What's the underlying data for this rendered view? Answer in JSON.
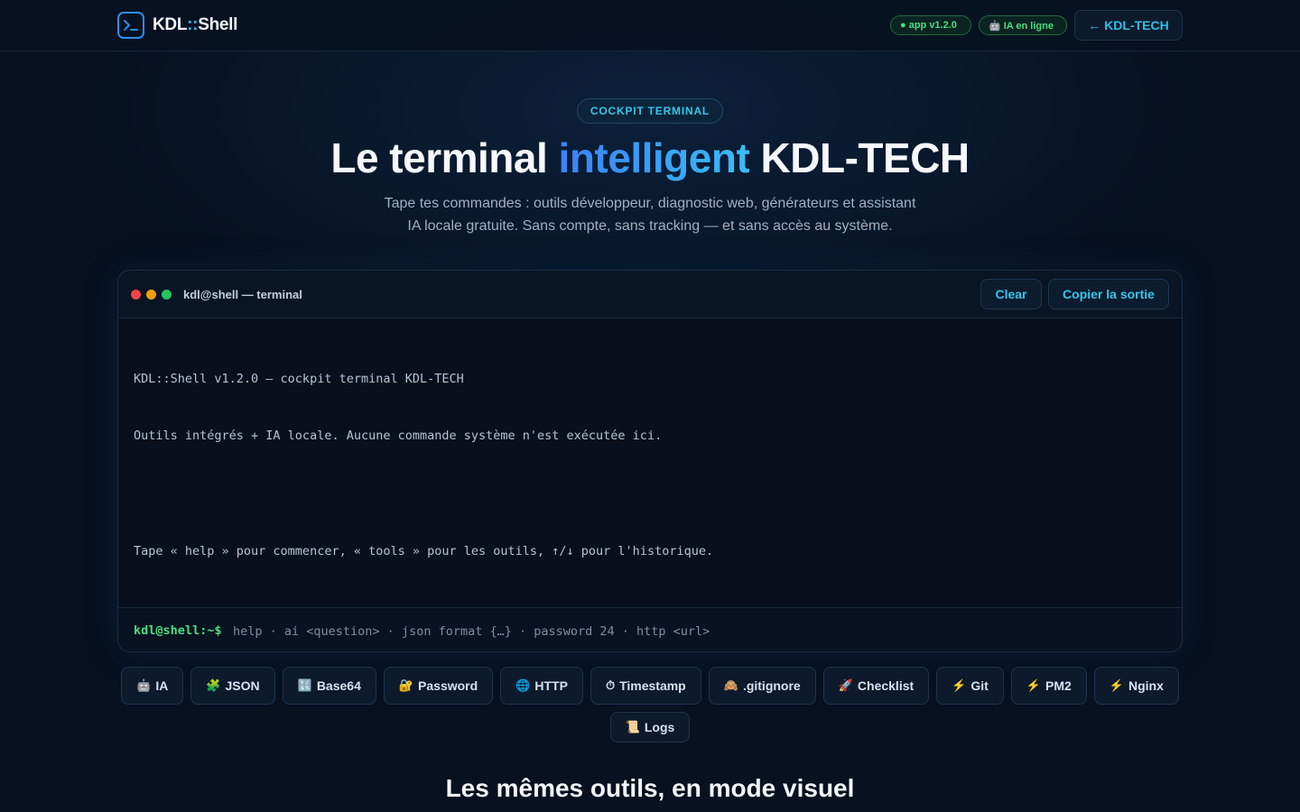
{
  "header": {
    "brand_prefix": "KDL",
    "brand_sep": "::",
    "brand_suffix": "Shell",
    "app_version": "● app v1.2.0",
    "ia_status": "🤖 IA en ligne",
    "back_link": "← KDL-TECH",
    "status_color": "#4ade80",
    "accent_color": "#2fc0e8"
  },
  "hero": {
    "badge": "COCKPIT TERMINAL",
    "title_start": "Le terminal ",
    "title_accent": "intelligent",
    "title_end": " KDL-TECH",
    "subtitle_line1": "Tape tes commandes : outils développeur, diagnostic web, générateurs et assistant",
    "subtitle_line2": "IA locale gratuite. Sans compte, sans tracking — et sans accès au système."
  },
  "terminal": {
    "title": "kdl@shell — terminal",
    "clear_label": "Clear",
    "copy_label": "Copier la sortie",
    "output": [
      "KDL::Shell v1.2.0 — cockpit terminal KDL-TECH",
      "Outils intégrés + IA locale. Aucune commande système n'est exécutée ici.",
      "Tape « help » pour commencer, « tools » pour les outils, ↑/↓ pour l'historique."
    ],
    "prompt": "kdl@shell:~$",
    "input_placeholder": "help · ai <question> · json format {…} · password 24 · http <url>"
  },
  "tools": [
    {
      "icon": "🤖",
      "label": "IA"
    },
    {
      "icon": "🧩",
      "label": "JSON"
    },
    {
      "icon": "🔣",
      "label": "Base64"
    },
    {
      "icon": "🔐",
      "label": "Password"
    },
    {
      "icon": "🌐",
      "label": "HTTP"
    },
    {
      "icon": "⏱",
      "label": "Timestamp"
    },
    {
      "icon": "🙈",
      "label": ".gitignore"
    },
    {
      "icon": "🚀",
      "label": "Checklist"
    },
    {
      "icon": "⚡",
      "label": "Git"
    },
    {
      "icon": "⚡",
      "label": "PM2"
    },
    {
      "icon": "⚡",
      "label": "Nginx"
    },
    {
      "icon": "📜",
      "label": "Logs"
    }
  ],
  "section": {
    "title": "Les mêmes outils, en mode visuel"
  }
}
